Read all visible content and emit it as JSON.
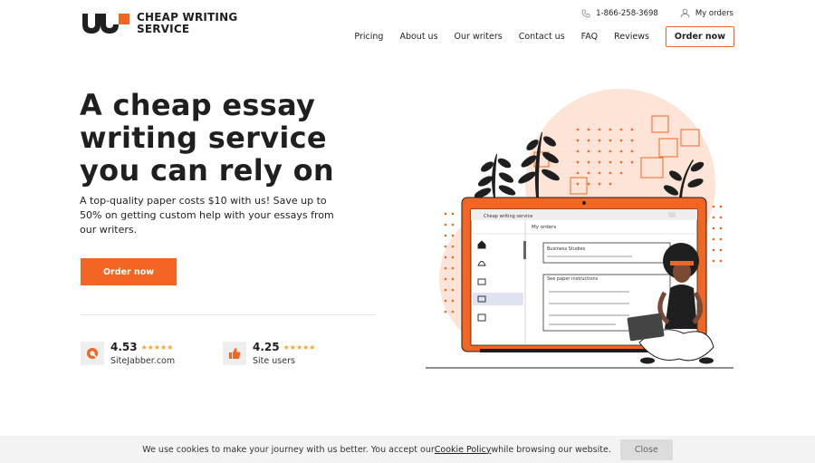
{
  "brand": {
    "name_line1": "CHEAP WRITING",
    "name_line2": "SERVICE",
    "accent": "#f26522"
  },
  "top_bar": {
    "phone": "1-866-258-3698",
    "my_orders": "My orders"
  },
  "nav": {
    "items": [
      "Pricing",
      "About us",
      "Our writers",
      "Contact us",
      "FAQ",
      "Reviews"
    ],
    "order_button": "Order now"
  },
  "hero": {
    "title": "A cheap essay writing service you can rely on",
    "subtitle": "A top-quality paper costs $10 with us! Save up to 50% on getting custom help with your essays from our writers.",
    "cta": "Order now"
  },
  "ratings": [
    {
      "score": "4.53",
      "stars": "★★★★★",
      "source": "SiteJabber.com",
      "icon": "sitejabber-icon"
    },
    {
      "score": "4.25",
      "stars": "★★★★★",
      "source": "Site users",
      "icon": "thumbs-up-icon"
    }
  ],
  "illustration": {
    "window_title": "Cheap writing service",
    "panel_title": "My orders",
    "order_1": "Business Studies",
    "order_2": "See paper instructions"
  },
  "cookie": {
    "text_before": "We use cookies to make your journey with us better. You accept our ",
    "link": "Cookie Policy",
    "text_after": " while browsing our website.",
    "close": "Close"
  }
}
